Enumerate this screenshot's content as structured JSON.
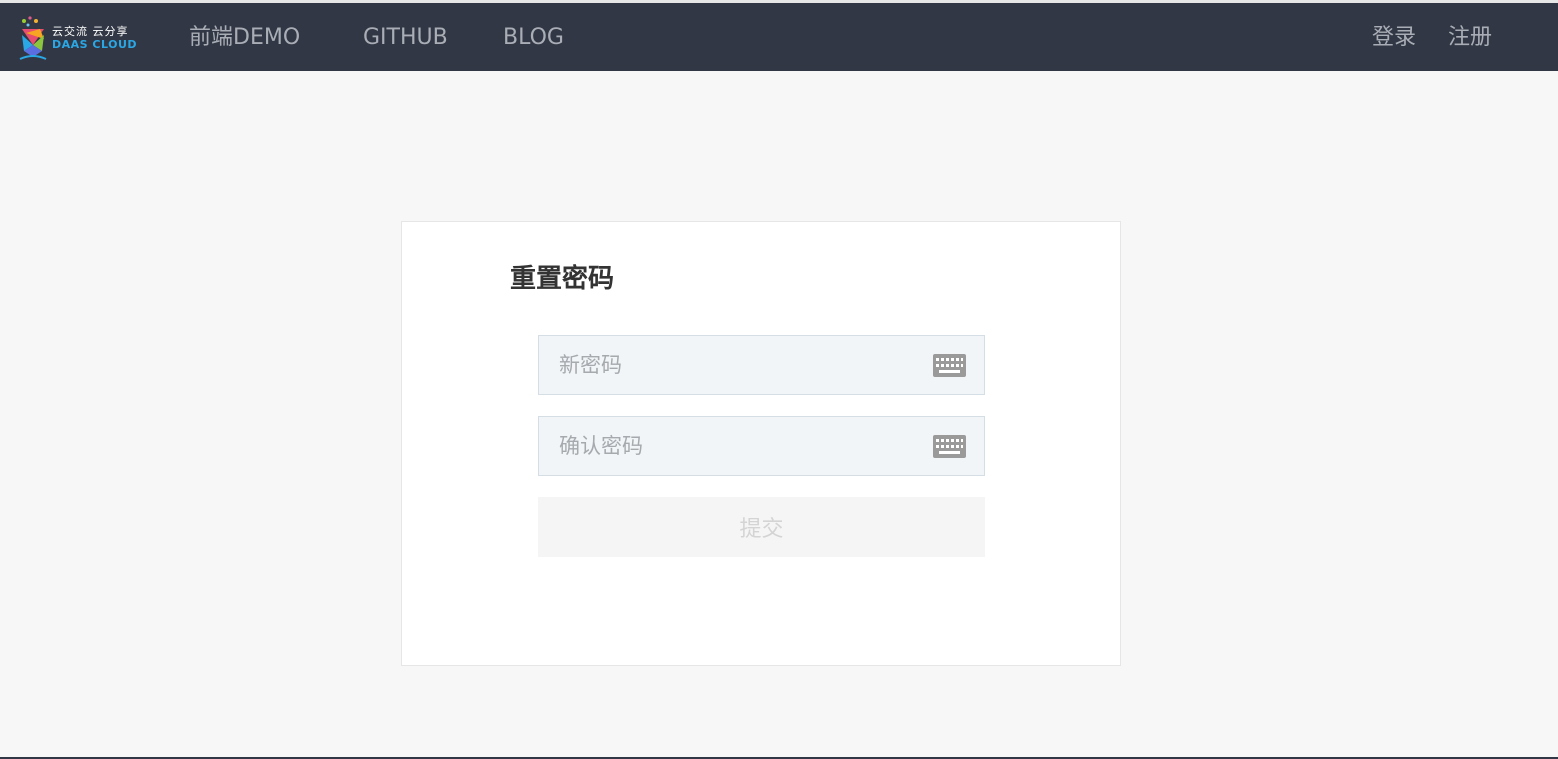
{
  "brand": {
    "logo_cn": "云交流 云分享",
    "logo_en": "DAAS CLOUD"
  },
  "nav": {
    "items": [
      {
        "label": "前端DEMO"
      },
      {
        "label": "GITHUB"
      },
      {
        "label": "BLOG"
      }
    ],
    "login_label": "登录",
    "register_label": "注册"
  },
  "form": {
    "title": "重置密码",
    "new_password": {
      "placeholder": "新密码",
      "value": ""
    },
    "confirm_password": {
      "placeholder": "确认密码",
      "value": ""
    },
    "submit_label": "提交"
  },
  "icons": {
    "keyboard": "keyboard-icon",
    "logo": "logo-icon"
  },
  "colors": {
    "topbar": "#313744",
    "nav_text": "#a9adb5",
    "logo_en": "#2aa8e6",
    "page_bg": "#f7f7f7",
    "field_bg": "#f2f5f8",
    "submit_text": "#d4d4d4"
  }
}
